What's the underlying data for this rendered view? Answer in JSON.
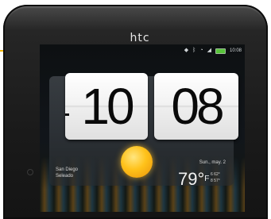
{
  "device": {
    "brand": "htc"
  },
  "status_bar": {
    "time": "10:08",
    "icons": [
      "notification-icon",
      "bluetooth-icon",
      "wifi-icon",
      "signal-icon",
      "battery-icon"
    ]
  },
  "clock_widget": {
    "hour": "10",
    "minute": "08",
    "city_line1": "San Diego",
    "city_line2": "Seleado",
    "date": "Sun., may. 2",
    "temperature": "79°",
    "temp_unit": "F",
    "high": "6 62°",
    "low": "8 57°",
    "weather_icon": "sun-icon"
  },
  "colors": {
    "callout": "#f0b400",
    "battery": "#58c43a",
    "sun": "#ffc21a"
  }
}
